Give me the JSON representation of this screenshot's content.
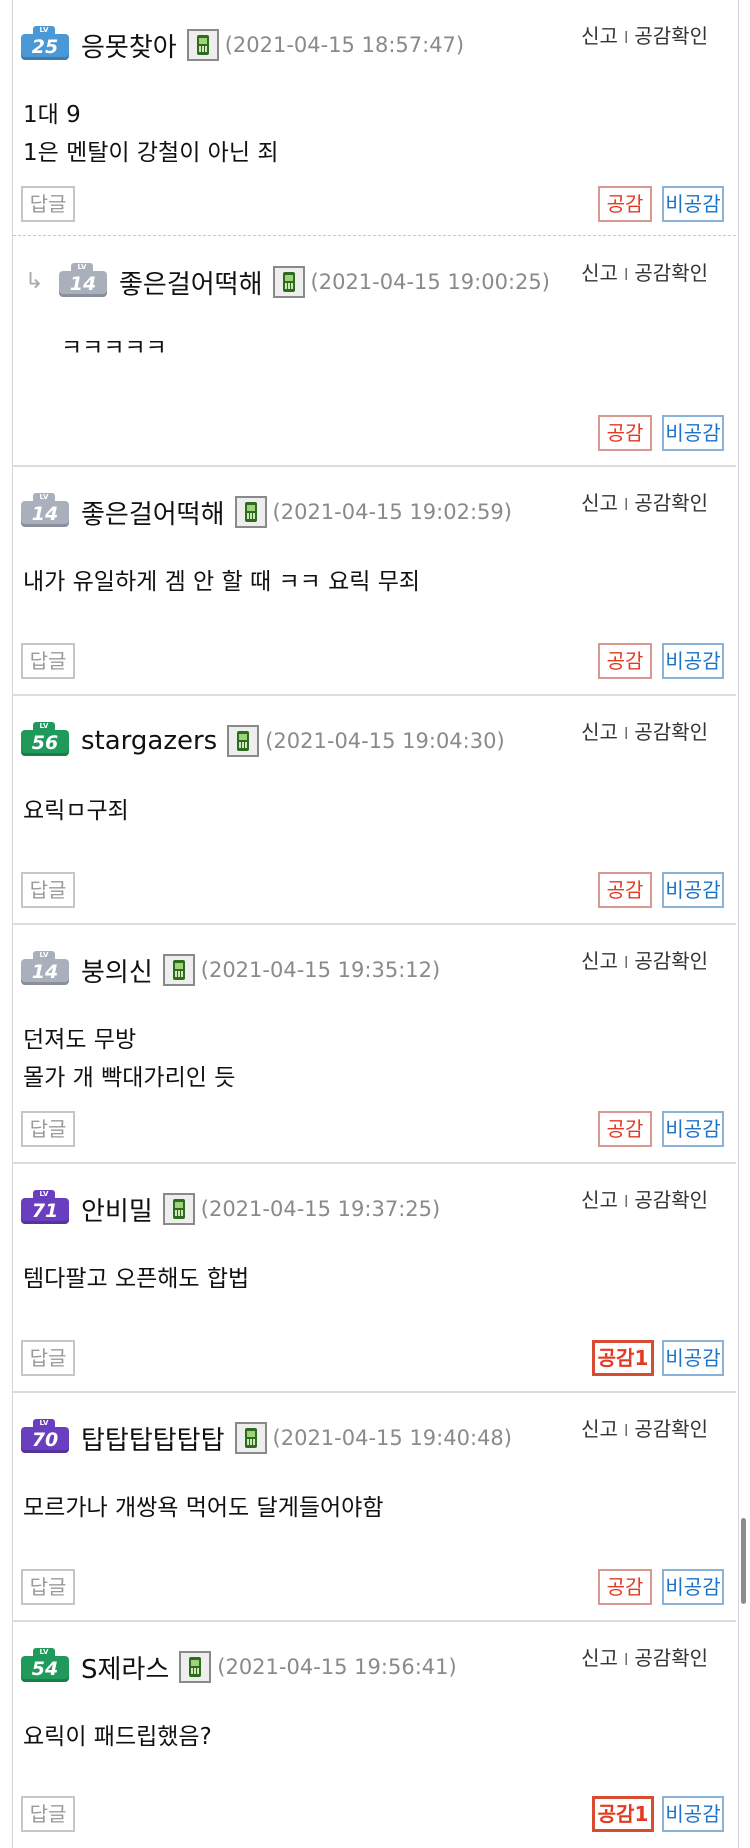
{
  "ui": {
    "report_label": "신고",
    "report_sep": "l",
    "agree_check_label": "공감확인",
    "reply_label": "답글",
    "agree_label": "공감",
    "disagree_label": "비공감",
    "lv_label": "LV"
  },
  "comments": [
    {
      "level": "25",
      "nick": "응못찾아",
      "date": "(2021-04-15 18:57:47)",
      "body": "1대 9\n1은 멘탈이 강철이 아닌 죄",
      "agree": "공감",
      "is_reply": false
    },
    {
      "level": "14",
      "nick": "좋은걸어떡해",
      "date": "(2021-04-15 19:00:25)",
      "body": "ㅋㅋㅋㅋㅋ",
      "agree": "공감",
      "is_reply": true
    },
    {
      "level": "14",
      "nick": "좋은걸어떡해",
      "date": "(2021-04-15 19:02:59)",
      "body": "내가 유일하게 겜 안 할 때 ㅋㅋ 요릭 무죄",
      "agree": "공감",
      "is_reply": false
    },
    {
      "level": "56",
      "nick": "stargazers",
      "date": "(2021-04-15 19:04:30)",
      "body": "요릭ㅁ구죄",
      "agree": "공감",
      "is_reply": false
    },
    {
      "level": "14",
      "nick": "붕의신",
      "date": "(2021-04-15 19:35:12)",
      "body": "던져도 무방\n몰가 개 빡대가리인 듯",
      "agree": "공감",
      "is_reply": false
    },
    {
      "level": "71",
      "nick": "안비밀",
      "date": "(2021-04-15 19:37:25)",
      "body": "템다팔고 오픈해도 합법",
      "agree": "공감1",
      "is_reply": false
    },
    {
      "level": "70",
      "nick": "탑탑탑탑탑탑",
      "date": "(2021-04-15 19:40:48)",
      "body": "모르가나 개쌍욕 먹어도 달게들어야함",
      "agree": "공감",
      "is_reply": false
    },
    {
      "level": "54",
      "nick": "S제라스",
      "date": "(2021-04-15 19:56:41)",
      "body": "요릭이 패드립했음?",
      "agree": "공감1",
      "is_reply": false
    }
  ],
  "colors": {
    "lv14": "#a9b0bb",
    "lv25": "#4a98d6",
    "lv54": "#1f9a5a",
    "lv56": "#1f9a5a",
    "lv70": "#6a3fbf",
    "lv71": "#6a3fbf"
  }
}
